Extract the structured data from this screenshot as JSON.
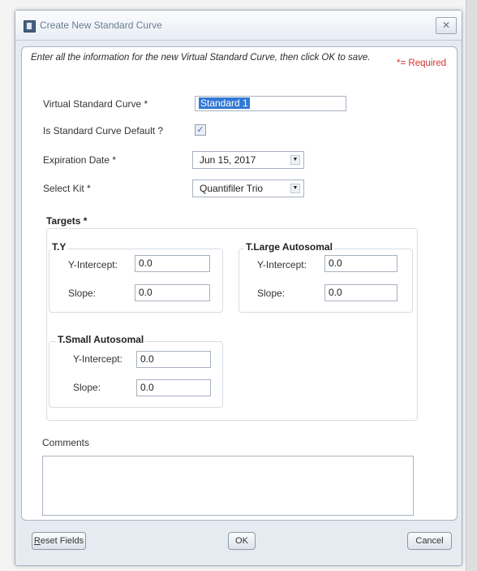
{
  "window": {
    "title": "Create New Standard Curve",
    "close_glyph": "✕"
  },
  "instructions": "Enter all the information for the new Virtual Standard Curve, then click OK to save.",
  "required_note": "*= Required",
  "form": {
    "curve_name": {
      "label": "Virtual Standard Curve *",
      "value": "Standard 1"
    },
    "is_default": {
      "label": "Is Standard Curve Default ?",
      "checked": true,
      "check_glyph": "✓"
    },
    "expiration": {
      "label": "Expiration Date *",
      "value": "Jun 15, 2017"
    },
    "kit": {
      "label": "Select Kit *",
      "value": "Quantifiler Trio"
    }
  },
  "targets": {
    "title": "Targets *",
    "groups": [
      {
        "title": "T.Y",
        "y_label": "Y-Intercept:",
        "y_value": "0.0",
        "slope_label": "Slope:",
        "slope_value": "0.0"
      },
      {
        "title": "T.Large Autosomal",
        "y_label": "Y-Intercept:",
        "y_value": "0.0",
        "slope_label": "Slope:",
        "slope_value": "0.0"
      },
      {
        "title": "T.Small Autosomal",
        "y_label": "Y-Intercept:",
        "y_value": "0.0",
        "slope_label": "Slope:",
        "slope_value": "0.0"
      }
    ]
  },
  "comments": {
    "label": "Comments",
    "value": ""
  },
  "buttons": {
    "reset_underlined": "R",
    "reset_rest": "eset Fields",
    "ok": "OK",
    "cancel": "Cancel"
  }
}
